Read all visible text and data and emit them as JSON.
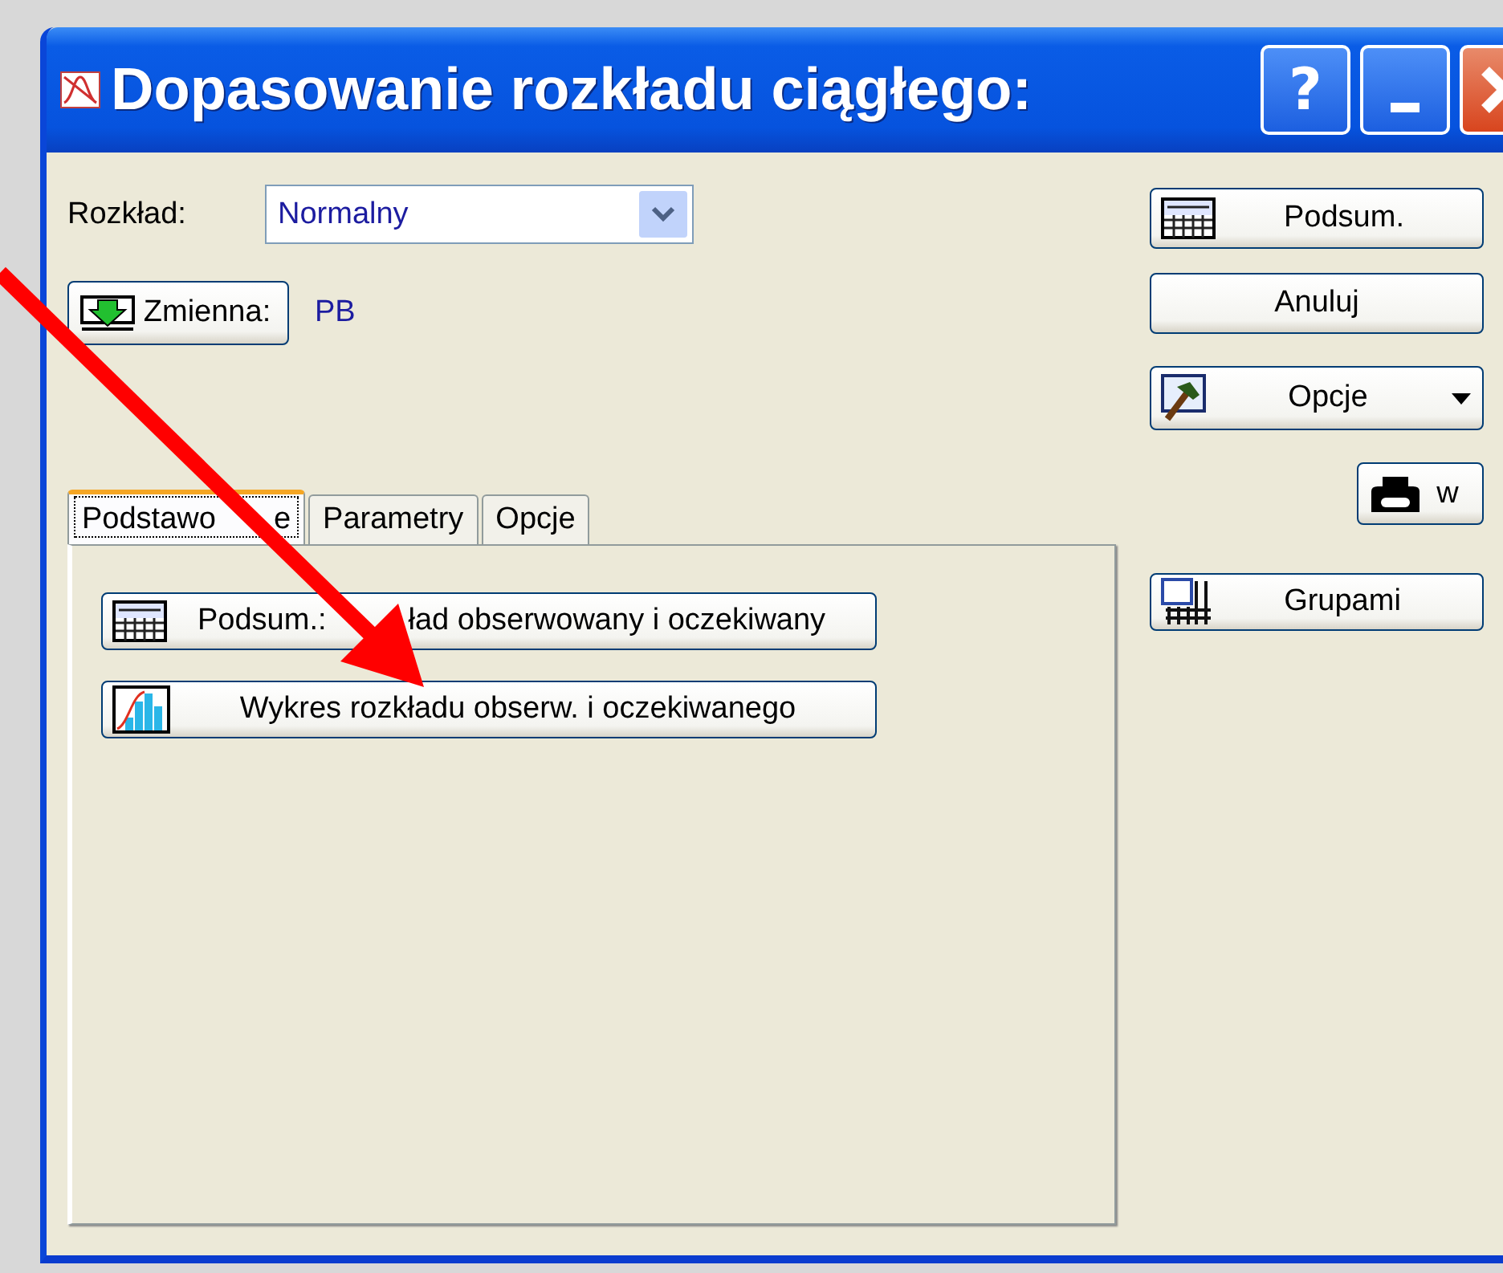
{
  "window": {
    "title": "Dopasowanie rozkładu ciągłego:",
    "title_buttons": [
      {
        "kind": "help",
        "label": "?"
      },
      {
        "kind": "minimize"
      },
      {
        "kind": "close"
      }
    ]
  },
  "distribution": {
    "label": "Rozkład:",
    "value": "Normalny"
  },
  "variable": {
    "button": "Zmienna:",
    "value": "PB"
  },
  "tabs": [
    {
      "label": "Podstawo",
      "label_end": "e",
      "selected": true
    },
    {
      "label": "Parametry",
      "selected": false
    },
    {
      "label": "Opcje",
      "selected": false
    }
  ],
  "tab_buttons": [
    {
      "kind": "summary",
      "label": "Podsum.:",
      "label_end": "ład obserwowany i oczekiwany"
    },
    {
      "kind": "chart",
      "label": "Wykres rozkładu obserw. i oczekiwanego"
    }
  ],
  "side_buttons": [
    {
      "kind": "summary",
      "label": "Podsum."
    },
    {
      "kind": "plain",
      "label": "Anuluj"
    },
    {
      "kind": "options",
      "label": "Opcje"
    },
    {
      "kind": "print",
      "label": "w"
    },
    {
      "kind": "groups",
      "label": "Grupami"
    }
  ]
}
